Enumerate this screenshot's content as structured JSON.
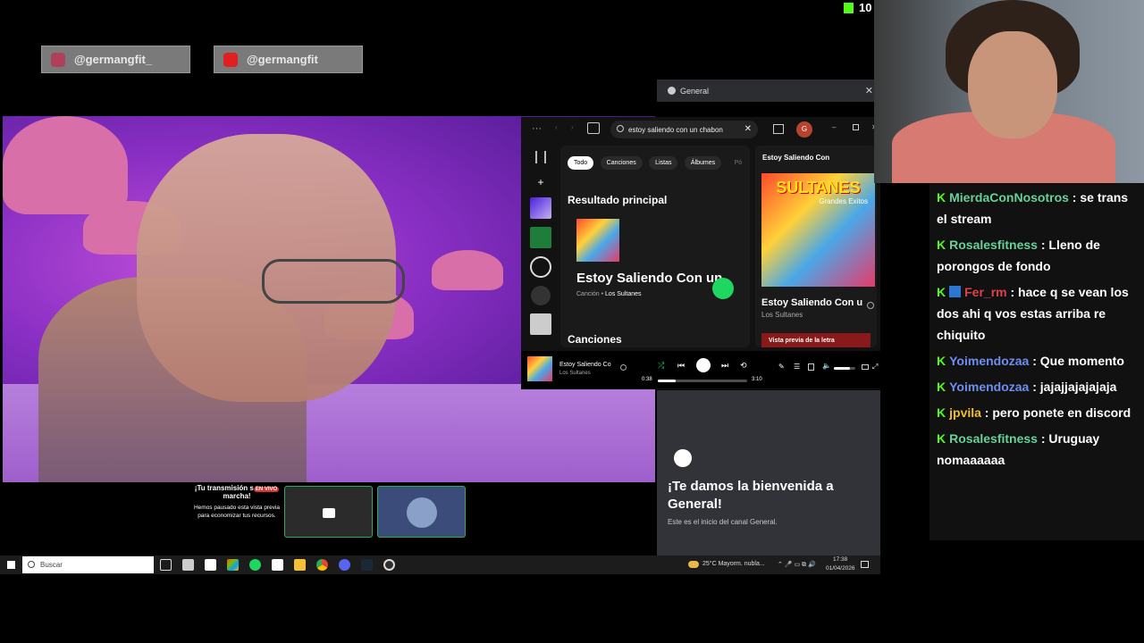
{
  "kick_counter": {
    "icon": "kick-logo-icon",
    "count": "10"
  },
  "socials": [
    {
      "icon": "instagram-icon",
      "handle": "@germangfit_"
    },
    {
      "icon": "youtube-icon",
      "handle": "@germangfit"
    }
  ],
  "discord_header": {
    "channel": "General",
    "close": "✕"
  },
  "spotify": {
    "search_value": "estoy saliendo con un chabon",
    "avatar_letter": "G",
    "filters": [
      "Todo",
      "Canciones",
      "Listas",
      "Álbumes",
      "Pó"
    ],
    "top_result_heading": "Resultado principal",
    "top_result": {
      "title": "Estoy Saliendo Con un",
      "type": "Canción",
      "artist": "Los Sultanes"
    },
    "songs_heading": "Canciones",
    "right_panel": {
      "header": "Estoy Saliendo Con",
      "cover_text": "SULTANES",
      "cover_sub": "Grandes Exitos",
      "title": "Estoy Saliendo Con u",
      "artist": "Los Sultanes",
      "lyrics_button": "Vista previa de la letra"
    },
    "player": {
      "title": "Estoy Saliendo Co",
      "artist": "Los Sultanes",
      "elapsed": "0:38",
      "duration": "3:10",
      "progress": 0.2,
      "volume": 0.75
    }
  },
  "discord_lower": {
    "welcome_title": "¡Te damos la bienvenida a General!",
    "welcome_sub": "Este es el inicio del canal General."
  },
  "preview": {
    "line1": "¡Tu transmisión s",
    "live_badge": "EN VIVO",
    "line2": "marcha!",
    "body": "Hemos pausado esta vista previa para economizar tus recursos."
  },
  "taskbar": {
    "search_placeholder": "Buscar",
    "weather": "25°C  Mayorm. nubla...",
    "time": "17:38",
    "date": "01/04/2026"
  },
  "chat": [
    {
      "user": "MierdaConNosotros",
      "text": "se trans el stream"
    },
    {
      "user": "Rosalesfitness",
      "text": "Lleno de porongos de fondo"
    },
    {
      "user": "Fer_rm",
      "text": "hace q se vean los dos ahi q vos estas arriba re chiquito"
    },
    {
      "user": "Yoimendozaa",
      "text": "Que momento"
    },
    {
      "user": "Yoimendozaa",
      "text": "jajajjajajajaja"
    },
    {
      "user": "jpvila",
      "text": "pero ponete en discord"
    },
    {
      "user": "Rosalesfitness",
      "text": "Uruguay nomaaaaaa"
    }
  ]
}
